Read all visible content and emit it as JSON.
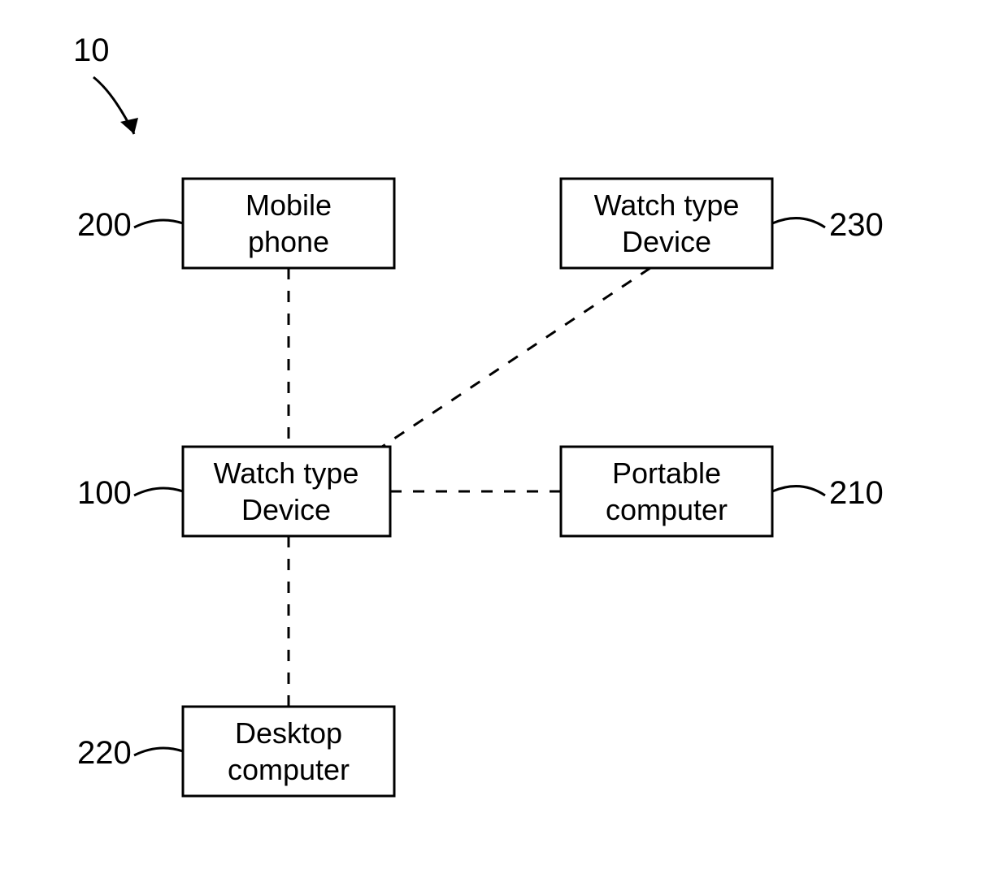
{
  "figure_number": "10",
  "nodes": {
    "center": {
      "ref": "100",
      "line1": "Watch type",
      "line2": "Device"
    },
    "top_left": {
      "ref": "200",
      "line1": "Mobile",
      "line2": "phone"
    },
    "top_right": {
      "ref": "230",
      "line1": "Watch type",
      "line2": "Device"
    },
    "right": {
      "ref": "210",
      "line1": "Portable",
      "line2": "computer"
    },
    "bottom": {
      "ref": "220",
      "line1": "Desktop",
      "line2": "computer"
    }
  }
}
